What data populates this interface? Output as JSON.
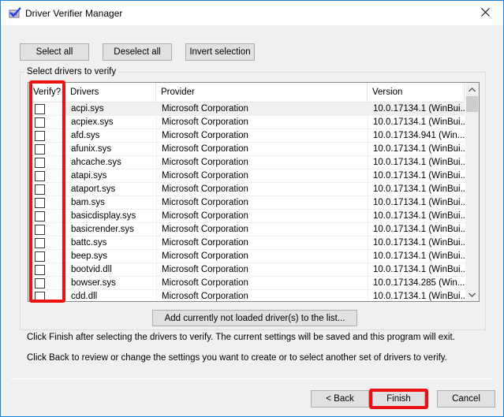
{
  "window": {
    "title": "Driver Verifier Manager",
    "icon": "driver-verifier-checkmark-icon",
    "close_icon": "close-icon"
  },
  "toolbar": {
    "select_all": "Select all",
    "deselect_all": "Deselect all",
    "invert_selection": "Invert selection"
  },
  "group": {
    "label": "Select drivers to verify"
  },
  "table": {
    "columns": [
      "Verify?",
      "Drivers",
      "Provider",
      "Version"
    ],
    "rows": [
      {
        "checked": false,
        "driver": "acpi.sys",
        "provider": "Microsoft Corporation",
        "version": "10.0.17134.1 (WinBui..."
      },
      {
        "checked": false,
        "driver": "acpiex.sys",
        "provider": "Microsoft Corporation",
        "version": "10.0.17134.1 (WinBui..."
      },
      {
        "checked": false,
        "driver": "afd.sys",
        "provider": "Microsoft Corporation",
        "version": "10.0.17134.941 (Win..."
      },
      {
        "checked": false,
        "driver": "afunix.sys",
        "provider": "Microsoft Corporation",
        "version": "10.0.17134.1 (WinBui..."
      },
      {
        "checked": false,
        "driver": "ahcache.sys",
        "provider": "Microsoft Corporation",
        "version": "10.0.17134.1 (WinBui..."
      },
      {
        "checked": false,
        "driver": "atapi.sys",
        "provider": "Microsoft Corporation",
        "version": "10.0.17134.1 (WinBui..."
      },
      {
        "checked": false,
        "driver": "ataport.sys",
        "provider": "Microsoft Corporation",
        "version": "10.0.17134.1 (WinBui..."
      },
      {
        "checked": false,
        "driver": "bam.sys",
        "provider": "Microsoft Corporation",
        "version": "10.0.17134.1 (WinBui..."
      },
      {
        "checked": false,
        "driver": "basicdisplay.sys",
        "provider": "Microsoft Corporation",
        "version": "10.0.17134.1 (WinBui..."
      },
      {
        "checked": false,
        "driver": "basicrender.sys",
        "provider": "Microsoft Corporation",
        "version": "10.0.17134.1 (WinBui..."
      },
      {
        "checked": false,
        "driver": "battc.sys",
        "provider": "Microsoft Corporation",
        "version": "10.0.17134.1 (WinBui..."
      },
      {
        "checked": false,
        "driver": "beep.sys",
        "provider": "Microsoft Corporation",
        "version": "10.0.17134.1 (WinBui..."
      },
      {
        "checked": false,
        "driver": "bootvid.dll",
        "provider": "Microsoft Corporation",
        "version": "10.0.17134.1 (WinBui..."
      },
      {
        "checked": false,
        "driver": "bowser.sys",
        "provider": "Microsoft Corporation",
        "version": "10.0.17134.285 (Win..."
      },
      {
        "checked": false,
        "driver": "cdd.dll",
        "provider": "Microsoft Corporation",
        "version": "10.0.17134.1 (WinBui..."
      }
    ]
  },
  "add_button": "Add currently not loaded driver(s) to the list...",
  "info": {
    "finish_text": "Click Finish after selecting the drivers to verify. The current settings will be saved and this program will exit.",
    "back_text": "Click Back to review or change the settings you want to create or to select another set of drivers to verify."
  },
  "footer": {
    "back": "< Back",
    "finish": "Finish",
    "cancel": "Cancel"
  },
  "colors": {
    "highlight": "#ee1111",
    "window_border": "#1883d7",
    "dialog_bg": "#f0f0f0"
  }
}
